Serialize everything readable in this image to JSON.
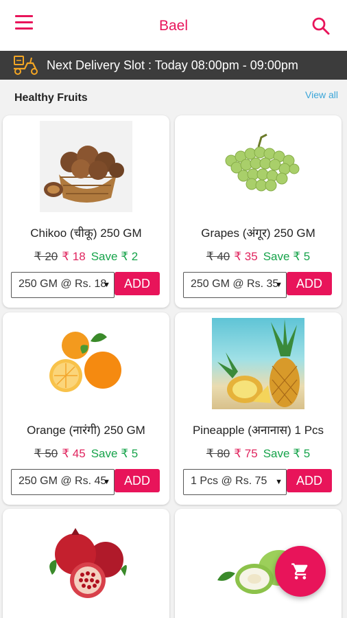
{
  "appbar": {
    "title": "Bael",
    "menu_icon": "hamburger-menu-icon",
    "search_icon": "search-icon"
  },
  "delivery": {
    "text": "Next Delivery Slot : Today 08:00pm - 09:00pm",
    "icon": "delivery-scooter-icon"
  },
  "section": {
    "title": "Healthy Fruits",
    "view_all": "View all"
  },
  "colors": {
    "brand": "#e8145a",
    "save": "#16a34a",
    "link": "#3aa5d8",
    "bar": "#3c3c3c"
  },
  "products": [
    {
      "name": "Chikoo (चीकू) 250 GM",
      "mrp": "₹ 20",
      "price": "₹ 18",
      "save": "Save ₹ 2",
      "option": "250 GM @ Rs. 18",
      "add": "ADD",
      "icon": "chikoo-image"
    },
    {
      "name": "Grapes (अंगूर) 250 GM",
      "mrp": "₹ 40",
      "price": "₹ 35",
      "save": "Save ₹ 5",
      "option": "250 GM @ Rs. 35",
      "add": "ADD",
      "icon": "grapes-image"
    },
    {
      "name": "Orange (नारंगी) 250 GM",
      "mrp": "₹ 50",
      "price": "₹ 45",
      "save": "Save ₹ 5",
      "option": "250 GM @ Rs. 45",
      "add": "ADD",
      "icon": "orange-image"
    },
    {
      "name": "Pineapple (अनानास) 1 Pcs",
      "mrp": "₹ 80",
      "price": "₹ 75",
      "save": "Save ₹ 5",
      "option": "1 Pcs @ Rs. 75",
      "add": "ADD",
      "icon": "pineapple-image"
    },
    {
      "icon": "pomegranate-image"
    },
    {
      "icon": "guava-image"
    }
  ],
  "cart": {
    "icon": "cart-icon"
  }
}
